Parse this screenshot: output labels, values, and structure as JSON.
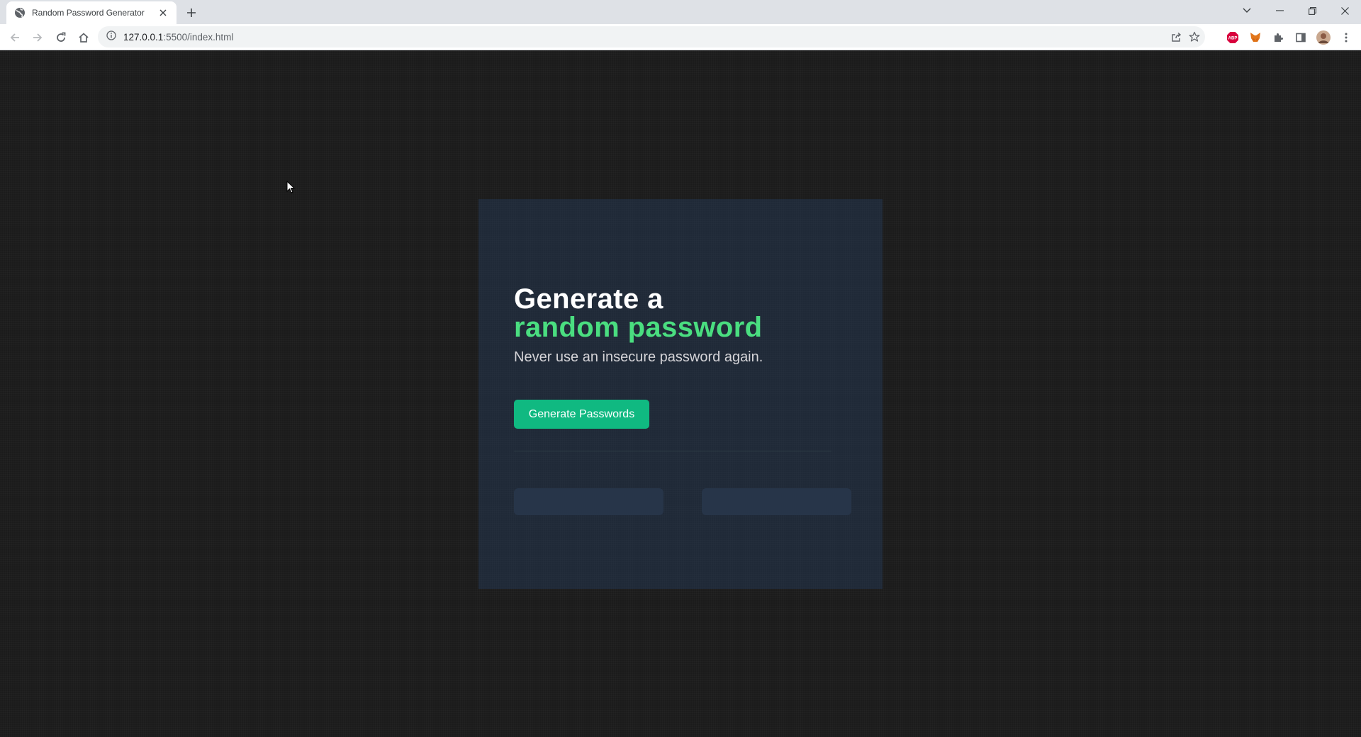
{
  "browser": {
    "tab": {
      "title": "Random Password Generator",
      "favicon": "globe-icon"
    },
    "toolbar": {
      "url_host": "127.0.0.1",
      "url_rest": ":5500/index.html",
      "extensions": [
        "abp-icon",
        "metamask-fox-icon",
        "puzzle-icon"
      ]
    }
  },
  "page": {
    "heading_line1": "Generate a",
    "heading_line2": "random password",
    "subtitle": "Never use an insecure password again.",
    "button_label": "Generate Passwords",
    "passwords": [
      "",
      ""
    ],
    "colors": {
      "background": "#1b1b1b",
      "card": "#1f2937",
      "accent_text": "#4ade80",
      "button": "#10b981",
      "password_box": "#273549",
      "subtitle": "#d5d4d8"
    }
  }
}
